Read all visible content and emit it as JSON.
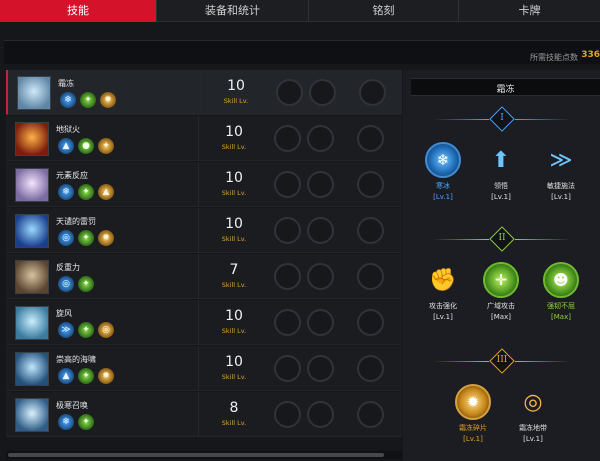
{
  "tabs": [
    "技能",
    "装备和统计",
    "铭刻",
    "卡牌"
  ],
  "active_tab": 0,
  "points": {
    "label": "所需技能点数",
    "value": "336"
  },
  "skills": [
    {
      "name": "霜冻",
      "level": "10",
      "level_label": "Skill Lv.",
      "icon": "frost-icon",
      "colors": [
        "#cfe8f8",
        "#5f86a6"
      ],
      "runes": [
        {
          "color": "blue",
          "glyph": "❄"
        },
        {
          "color": "green",
          "glyph": "✦"
        },
        {
          "color": "gold",
          "glyph": "✹"
        }
      ]
    },
    {
      "name": "地狱火",
      "level": "10",
      "level_label": "Skill Lv.",
      "icon": "hellfire-icon",
      "colors": [
        "#ffb14a",
        "#7a1d0a"
      ],
      "runes": [
        {
          "color": "blue",
          "glyph": "▲"
        },
        {
          "color": "green",
          "glyph": "●"
        },
        {
          "color": "gold",
          "glyph": "✦"
        }
      ]
    },
    {
      "name": "元素反应",
      "level": "10",
      "level_label": "Skill Lv.",
      "icon": "elemental-reaction-icon",
      "colors": [
        "#f5e3ff",
        "#7a6aa0"
      ],
      "runes": [
        {
          "color": "blue",
          "glyph": "❄"
        },
        {
          "color": "green",
          "glyph": "✦"
        },
        {
          "color": "gold",
          "glyph": "▲"
        }
      ]
    },
    {
      "name": "天谴的雷罚",
      "level": "10",
      "level_label": "Skill Lv.",
      "icon": "thunder-judgment-icon",
      "colors": [
        "#9ad7ff",
        "#1b3f8c"
      ],
      "runes": [
        {
          "color": "blue",
          "glyph": "◎"
        },
        {
          "color": "green",
          "glyph": "✦"
        },
        {
          "color": "gold",
          "glyph": "✹"
        }
      ]
    },
    {
      "name": "反重力",
      "level": "7",
      "level_label": "Skill Lv.",
      "icon": "anti-gravity-icon",
      "colors": [
        "#d8c2a0",
        "#5a4630"
      ],
      "runes": [
        {
          "color": "blue",
          "glyph": "◎"
        },
        {
          "color": "green",
          "glyph": "✦"
        }
      ]
    },
    {
      "name": "旋风",
      "level": "10",
      "level_label": "Skill Lv.",
      "icon": "whirlwind-icon",
      "colors": [
        "#c8f0ff",
        "#3a7aa0"
      ],
      "runes": [
        {
          "color": "blue",
          "glyph": "≫"
        },
        {
          "color": "green",
          "glyph": "✦"
        },
        {
          "color": "gold",
          "glyph": "◎"
        }
      ]
    },
    {
      "name": "崇高的海啸",
      "level": "10",
      "level_label": "Skill Lv.",
      "icon": "tsunami-icon",
      "colors": [
        "#bfe6ff",
        "#24517a"
      ],
      "runes": [
        {
          "color": "blue",
          "glyph": "▲"
        },
        {
          "color": "green",
          "glyph": "✦"
        },
        {
          "color": "gold",
          "glyph": "✹"
        }
      ]
    },
    {
      "name": "极寒召唤",
      "level": "8",
      "level_label": "Skill Lv.",
      "icon": "frost-summon-icon",
      "colors": [
        "#d9f1ff",
        "#2f5d88"
      ],
      "runes": [
        {
          "color": "blue",
          "glyph": "❄"
        },
        {
          "color": "green",
          "glyph": "✦"
        }
      ]
    }
  ],
  "detail": {
    "title": "霜冻",
    "tiers": [
      {
        "numeral": "I",
        "color": "#4aa3ff",
        "nodes": [
          {
            "label": "寒冰",
            "level": "[Lv.1]",
            "style": "blue",
            "glyph": "❄",
            "label_color": "#4aa3ff",
            "icon": "frost-rune-icon"
          },
          {
            "label": "领悟",
            "level": "[Lv.1]",
            "style": "plain",
            "glyph": "⬆",
            "label_color": "#e0e0e0",
            "icon": "insight-icon"
          },
          {
            "label": "敏捷施法",
            "level": "[Lv.1]",
            "style": "plain",
            "glyph": "≫",
            "label_color": "#e0e0e0",
            "icon": "quick-cast-icon"
          }
        ]
      },
      {
        "numeral": "II",
        "color": "#8ed04a",
        "nodes": [
          {
            "label": "攻击强化",
            "level": "[Lv.1]",
            "style": "plain-green",
            "glyph": "✊",
            "label_color": "#e0e0e0",
            "icon": "attack-boost-icon"
          },
          {
            "label": "广域攻击",
            "level": "[Max]",
            "style": "green",
            "glyph": "✛",
            "label_color": "#e0e0e0",
            "icon": "wide-area-icon"
          },
          {
            "label": "强韧不屈",
            "level": "[Max]",
            "style": "green",
            "glyph": "☻",
            "label_color": "#8ed04a",
            "icon": "tenacity-icon"
          }
        ]
      },
      {
        "numeral": "III",
        "color": "#e6a227",
        "nodes": [
          {
            "label": "霜冻碎片",
            "level": "[Lv.1]",
            "style": "gold",
            "glyph": "✹",
            "label_color": "#e6a227",
            "icon": "frost-shard-icon"
          },
          {
            "label": "霜冻地带",
            "level": "[Lv.1]",
            "style": "plain-gold",
            "glyph": "◎",
            "label_color": "#e0e0e0",
            "icon": "frost-zone-icon"
          }
        ]
      }
    ]
  }
}
